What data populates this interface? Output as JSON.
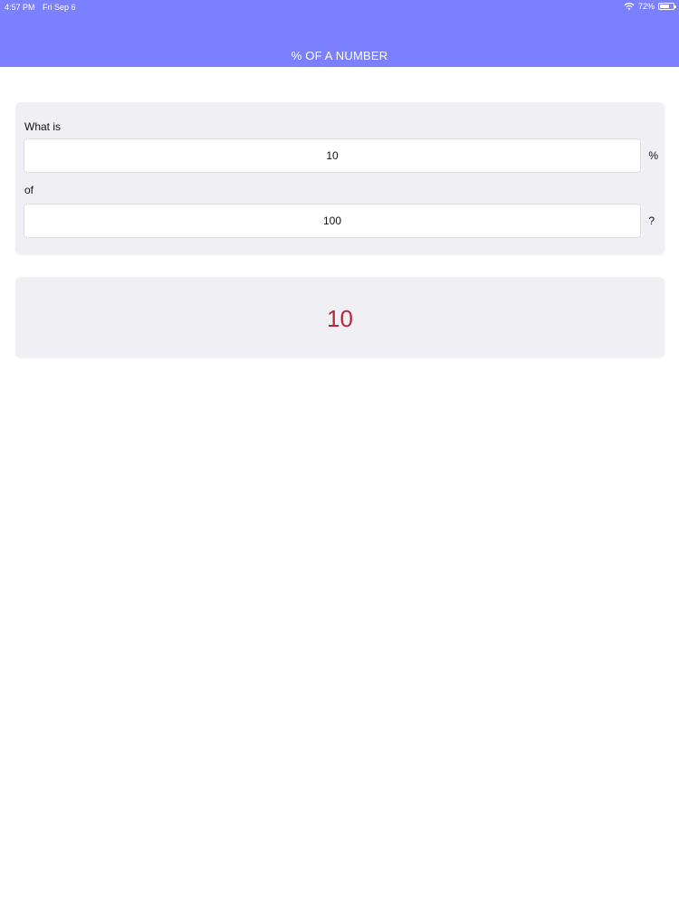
{
  "status_bar": {
    "time": "4:57 PM",
    "date": "Fri Sep 6",
    "battery_percent": "72%",
    "battery_level": 0.72,
    "wifi_icon": "wifi-icon",
    "battery_icon": "battery-icon"
  },
  "nav": {
    "title": "% OF A NUMBER",
    "background_color": "#7b80fe"
  },
  "form": {
    "what_is_label": "What is",
    "percent_value": "10",
    "percent_suffix": "%",
    "of_label": "of",
    "number_value": "100",
    "question_suffix": "?"
  },
  "result": {
    "value": "10",
    "color": "#b2283d"
  }
}
